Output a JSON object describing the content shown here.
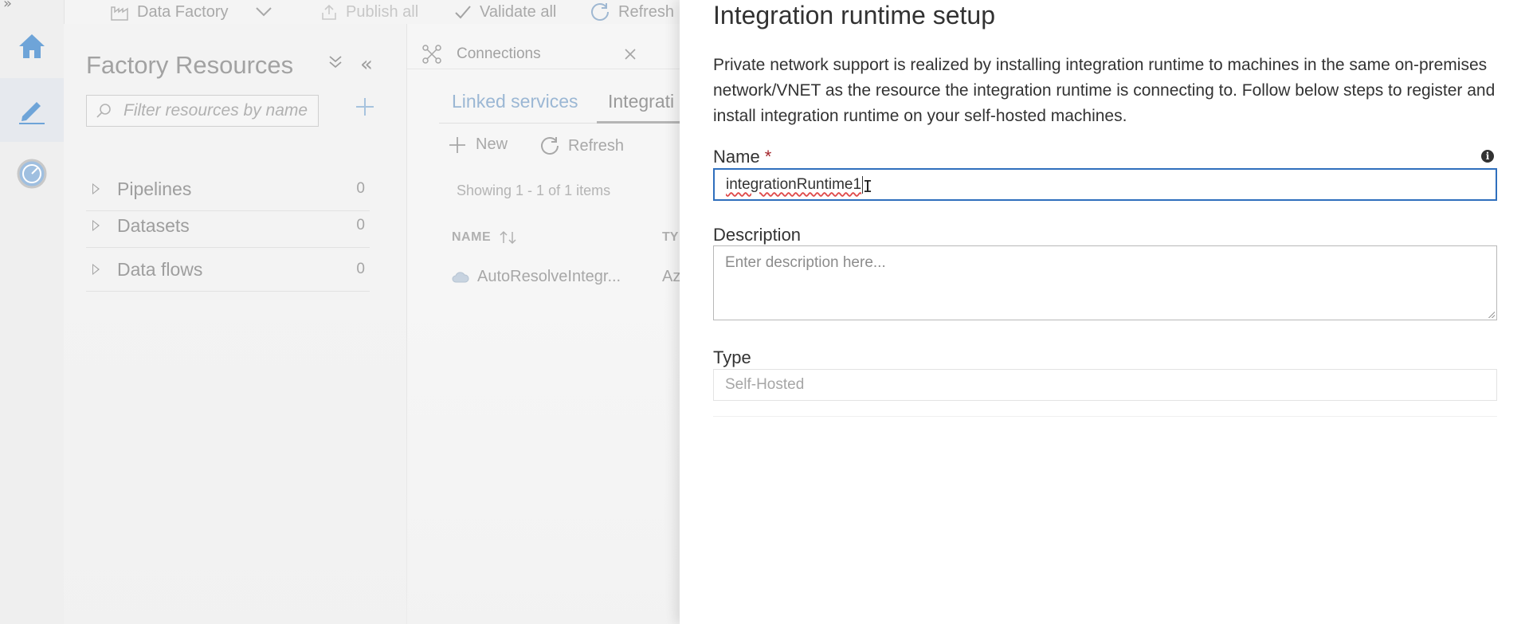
{
  "toolbar": {
    "factory_label": "Data Factory",
    "publish_label": "Publish all",
    "validate_label": "Validate all",
    "refresh_label": "Refresh"
  },
  "resources": {
    "title": "Factory Resources",
    "filter_placeholder": "Filter resources by name",
    "items": [
      {
        "label": "Pipelines",
        "count": "0"
      },
      {
        "label": "Datasets",
        "count": "0"
      },
      {
        "label": "Data flows",
        "count": "0"
      }
    ]
  },
  "connections": {
    "tab_label": "Connections",
    "subtabs": [
      "Linked services",
      "Integrati"
    ],
    "new_label": "New",
    "refresh_label": "Refresh",
    "showing": "Showing 1 - 1 of 1 items",
    "columns": {
      "name": "NAME",
      "type": "TY"
    },
    "rows": [
      {
        "name": "AutoResolveIntegr...",
        "type": "Az"
      }
    ]
  },
  "dialog": {
    "title": "Integration runtime setup",
    "description": "Private network support is realized by installing integration runtime to machines in the same on-premises network/VNET as the resource the integration runtime is connecting to. Follow below steps to register and install integration runtime on your self-hosted machines.",
    "name_label": "Name",
    "required_mark": "*",
    "name_value": "integrationRuntime1",
    "description_label": "Description",
    "description_placeholder": "Enter description here...",
    "type_label": "Type",
    "type_value": "Self-Hosted"
  },
  "colors": {
    "accent": "#2f6fbd",
    "required": "#a4262c",
    "rail_icon": "#5b9bd5"
  },
  "icons": [
    "home-icon",
    "pencil-icon",
    "monitor-gauge-icon",
    "factory-icon",
    "chevron-down-icon",
    "publish-icon",
    "check-icon",
    "refresh-icon",
    "collapse-all-icon",
    "collapse-pane-icon",
    "search-icon",
    "plus-icon",
    "connections-icon",
    "close-icon",
    "sort-icon",
    "cloud-icon",
    "info-icon"
  ]
}
